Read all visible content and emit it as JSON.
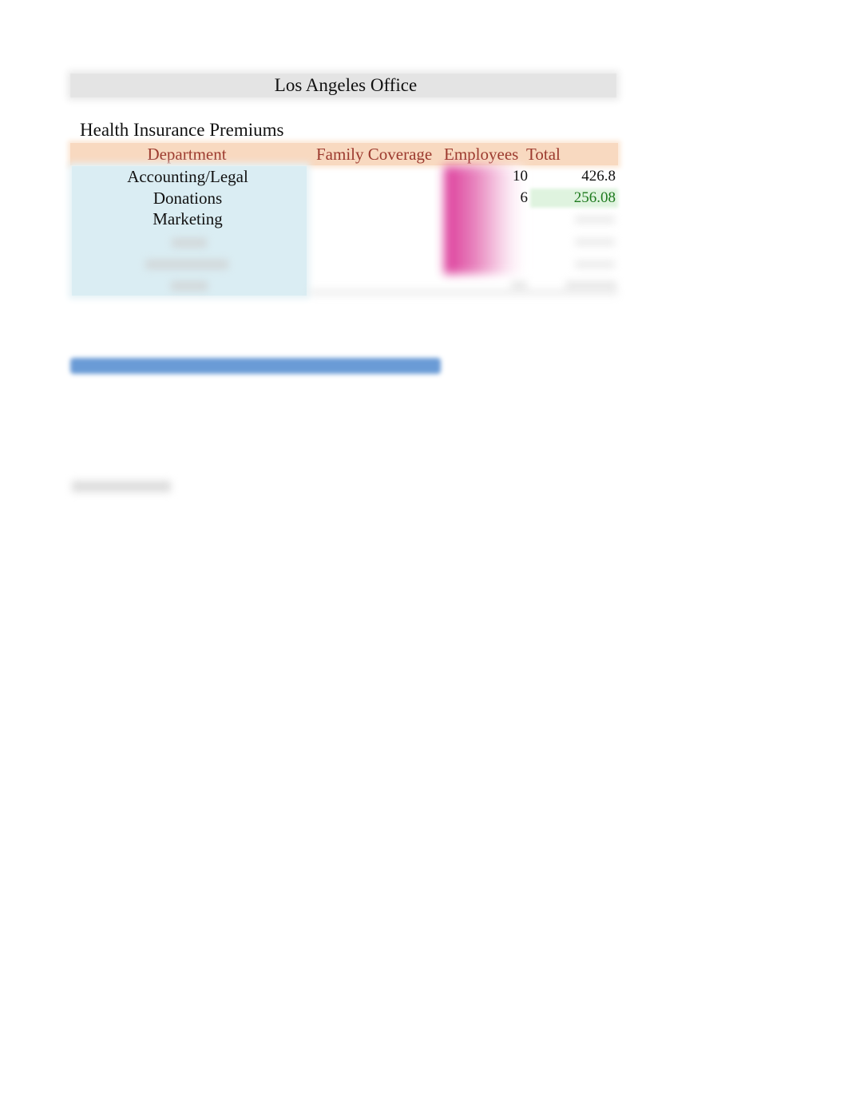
{
  "sheet": {
    "title": "Los Angeles Office",
    "section_title": "Health Insurance Premiums",
    "columns": [
      "Department",
      "Family Coverage",
      "Employees",
      "Total"
    ],
    "rows": [
      {
        "department": "Accounting/Legal",
        "family_coverage": "",
        "employees": "10",
        "total": "426.8"
      },
      {
        "department": "Donations",
        "family_coverage": "",
        "employees": "6",
        "total": "256.08"
      },
      {
        "department": "Marketing",
        "family_coverage": "",
        "employees": "",
        "total": ""
      }
    ],
    "colors": {
      "header_bg": "#f8d9c0",
      "header_text": "#9c3a2e",
      "department_bg": "#daedf3",
      "highlight_total": "#1e7a1e",
      "highlight_total_bg": "#dff3df",
      "employees_bar": "#d9258f",
      "bottom_bar": "#6a9bd6"
    }
  }
}
